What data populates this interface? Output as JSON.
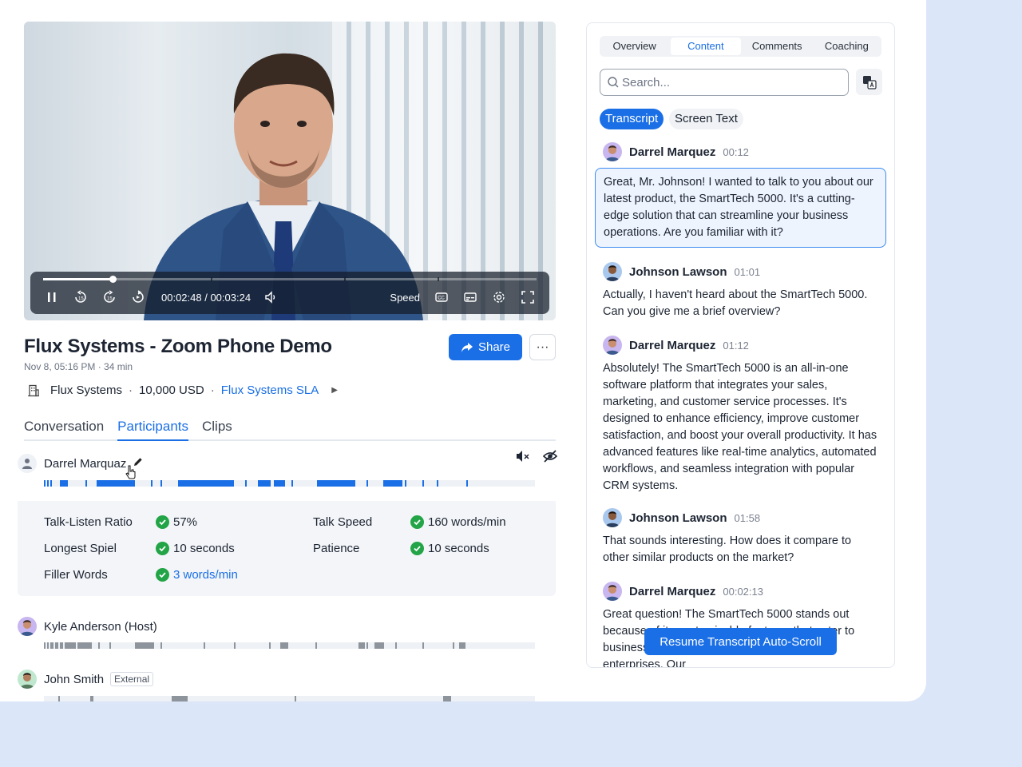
{
  "video": {
    "time": "00:02:48 / 00:03:24",
    "speed_label": "Speed",
    "progress": 0.14
  },
  "meeting": {
    "title": "Flux Systems - Zoom Phone Demo",
    "meta": "Nov 8, 05:16 PM · 34 min",
    "share_label": "Share",
    "more_label": "···",
    "company": "Flux Systems",
    "amount": "10,000 USD",
    "deal_link": "Flux Systems SLA",
    "dot": "·"
  },
  "tabs": [
    "Conversation",
    "Participants",
    "Clips"
  ],
  "participants": [
    {
      "name": "Darrel Marquaz"
    },
    {
      "name": "Kyle Anderson (Host)"
    },
    {
      "name": "John Smith",
      "badge": "External"
    }
  ],
  "stats": {
    "talk_listen_label": "Talk-Listen Ratio",
    "talk_listen_value": "57%",
    "longest_spiel_label": "Longest Spiel",
    "longest_spiel_value": "10 seconds",
    "filler_words_label": "Filler Words",
    "filler_words_value": "3 words/min",
    "talk_speed_label": "Talk Speed",
    "talk_speed_value": "160 words/min",
    "patience_label": "Patience",
    "patience_value": "10 seconds"
  },
  "panel": {
    "tabs": [
      "Overview",
      "Content",
      "Comments",
      "Coaching"
    ],
    "search_placeholder": "Search...",
    "pill_transcript": "Transcript",
    "pill_screen": "Screen Text",
    "resume_label": "Resume Transcript Auto-Scroll"
  },
  "transcript": [
    {
      "speaker": "Darrel Marquez",
      "time": "00:12",
      "text": "Great, Mr. Johnson! I wanted to talk to you about our latest product, the SmartTech 5000. It's a cutting-edge solution that can streamline your business operations. Are you familiar with it?"
    },
    {
      "speaker": "Johnson Lawson",
      "time": "01:01",
      "text": "Actually, I haven't heard about the SmartTech 5000. Can you give me a brief overview?"
    },
    {
      "speaker": "Darrel Marquez",
      "time": "01:12",
      "text": "Absolutely! The SmartTech 5000 is an all-in-one software platform that integrates your sales, marketing, and customer service processes. It's designed to enhance efficiency, improve customer satisfaction, and boost your overall productivity. It has advanced features like real-time analytics, automated workflows, and seamless integration with popular CRM systems."
    },
    {
      "speaker": "Johnson Lawson",
      "time": "01:58",
      "text": "That sounds interesting. How does it compare to other similar products on the market?"
    },
    {
      "speaker": "Darrel Marquez",
      "time": "00:02:13",
      "text": "Great question! The SmartTech 5000 stands out because of its customizable features that cater to businesses of all sizes, from startups to large enterprises. Our"
    }
  ],
  "colors": {
    "accent": "#1a6fe6",
    "success": "#22a447",
    "highlight": "#f4c443"
  }
}
